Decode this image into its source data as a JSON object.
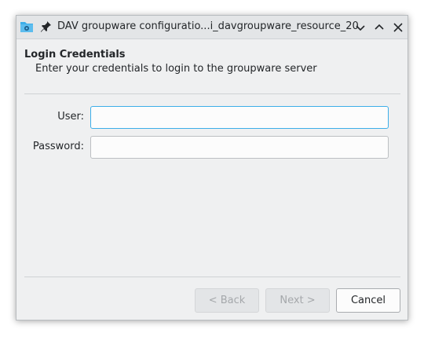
{
  "window": {
    "title": "DAV groupware configuratio...i_davgroupware_resource_20",
    "app_icon": "folder-icon",
    "pin_icon": "pin-icon",
    "controls": [
      "minimize-icon",
      "maximize-icon",
      "close-icon"
    ]
  },
  "page": {
    "title": "Login Credentials",
    "subtitle": "Enter your credentials to login to the groupware server"
  },
  "form": {
    "user_label": "User:",
    "user_value": "",
    "password_label": "Password:",
    "password_value": ""
  },
  "buttons": {
    "back_label": "< Back",
    "next_label": "Next >",
    "cancel_label": "Cancel"
  },
  "colors": {
    "focus_accent": "#3daee9",
    "folder_icon": "#3daee9",
    "window_bg": "#eff0f1"
  }
}
